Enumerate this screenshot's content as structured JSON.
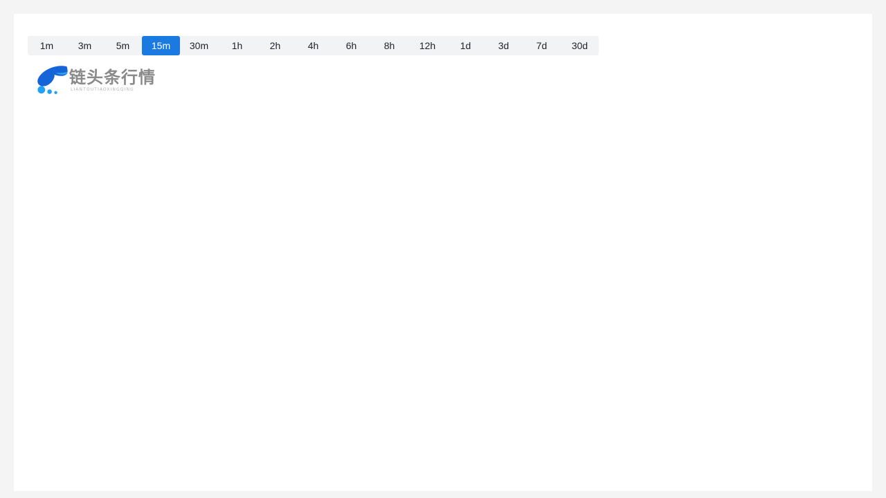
{
  "page": {
    "background_color": "#f4f4f5",
    "card_background_color": "#ffffff"
  },
  "timeframe_selector": {
    "name": "timeframe-selector",
    "background_color": "#f2f3f5",
    "active_color": "#1a7ae0",
    "active_text_color": "#ffffff",
    "inactive_text_color": "#1d2129",
    "selected": "15m",
    "options": [
      {
        "label": "1m",
        "active": false
      },
      {
        "label": "3m",
        "active": false
      },
      {
        "label": "5m",
        "active": false
      },
      {
        "label": "15m",
        "active": true
      },
      {
        "label": "30m",
        "active": false
      },
      {
        "label": "1h",
        "active": false
      },
      {
        "label": "2h",
        "active": false
      },
      {
        "label": "4h",
        "active": false
      },
      {
        "label": "6h",
        "active": false
      },
      {
        "label": "8h",
        "active": false
      },
      {
        "label": "12h",
        "active": false
      },
      {
        "label": "1d",
        "active": false
      },
      {
        "label": "3d",
        "active": false
      },
      {
        "label": "7d",
        "active": false
      },
      {
        "label": "30d",
        "active": false
      }
    ]
  },
  "logo": {
    "icon_name": "swoosh-dots-logo-icon",
    "title": "链头条行情",
    "subtitle": "LIANTOUTIAOXINGQING",
    "title_color": "#8a8a8a",
    "subtitle_color": "#b4b4b4",
    "mark_color_primary": "#1565d8",
    "mark_color_secondary": "#2ea7f0",
    "mark_color_dot": "#1fa2f5"
  },
  "chart_area": {
    "name": "chart-canvas",
    "state": "empty"
  }
}
